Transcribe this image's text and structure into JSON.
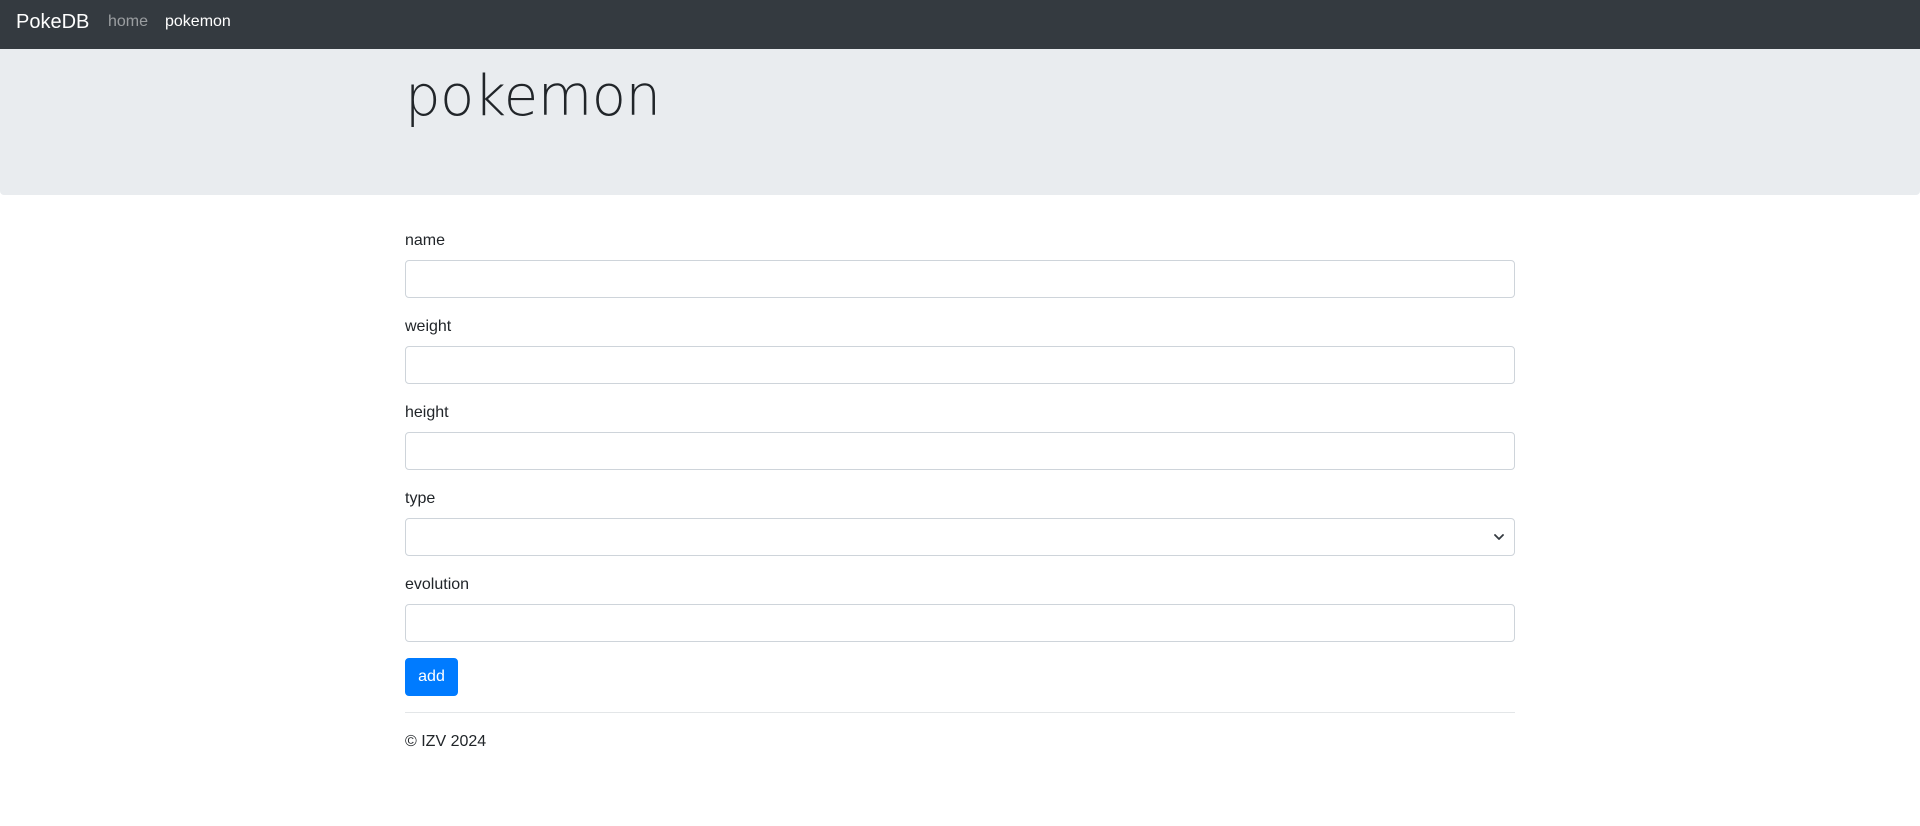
{
  "navbar": {
    "brand": "PokeDB",
    "links": [
      {
        "label": "home"
      },
      {
        "label": "pokemon"
      }
    ]
  },
  "header": {
    "title": "pokemon"
  },
  "form": {
    "fields": [
      {
        "label": "name",
        "value": ""
      },
      {
        "label": "weight",
        "value": ""
      },
      {
        "label": "height",
        "value": ""
      },
      {
        "label": "type",
        "value": ""
      },
      {
        "label": "evolution",
        "value": ""
      }
    ],
    "submit_label": "add"
  },
  "footer": {
    "text": "© IZV 2024"
  },
  "colors": {
    "navbar": "#343a40",
    "jumbotron": "#e9ecef",
    "primary": "#007bff"
  }
}
